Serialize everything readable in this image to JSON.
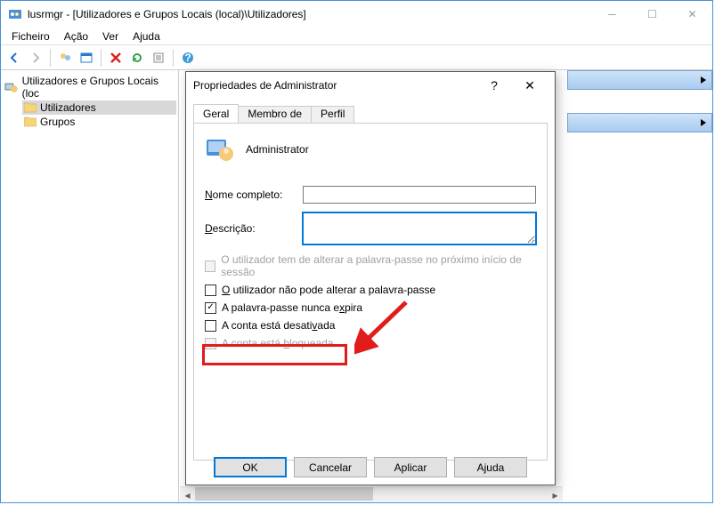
{
  "window": {
    "title": "lusrmgr - [Utilizadores e Grupos Locais (local)\\Utilizadores]"
  },
  "menu": {
    "ficheiro": "Ficheiro",
    "acao": "Ação",
    "ver": "Ver",
    "ajuda": "Ajuda"
  },
  "tree": {
    "root": "Utilizadores e Grupos Locais (loc",
    "utilizadores": "Utilizadores",
    "grupos": "Grupos"
  },
  "dialog": {
    "title": "Propriedades de Administrator",
    "tabs": {
      "geral": "Geral",
      "membro": "Membro de",
      "perfil": "Perfil"
    },
    "username": "Administrator",
    "labels": {
      "nome": "Nome completo:",
      "desc": "Descrição:"
    },
    "fields": {
      "nome": "",
      "desc": ""
    },
    "checks": {
      "must_change": "O utilizador tem de alterar a palavra-passe no próximo início de sessão",
      "cannot_change": "O utilizador não pode alterar a palavra-passe",
      "never_expires": "A palavra-passe nunca expira",
      "disabled": "A conta está desativada",
      "locked": "A conta está bloqueada"
    },
    "buttons": {
      "ok": "OK",
      "cancelar": "Cancelar",
      "aplicar": "Aplicar",
      "ajuda": "Ajuda"
    }
  }
}
